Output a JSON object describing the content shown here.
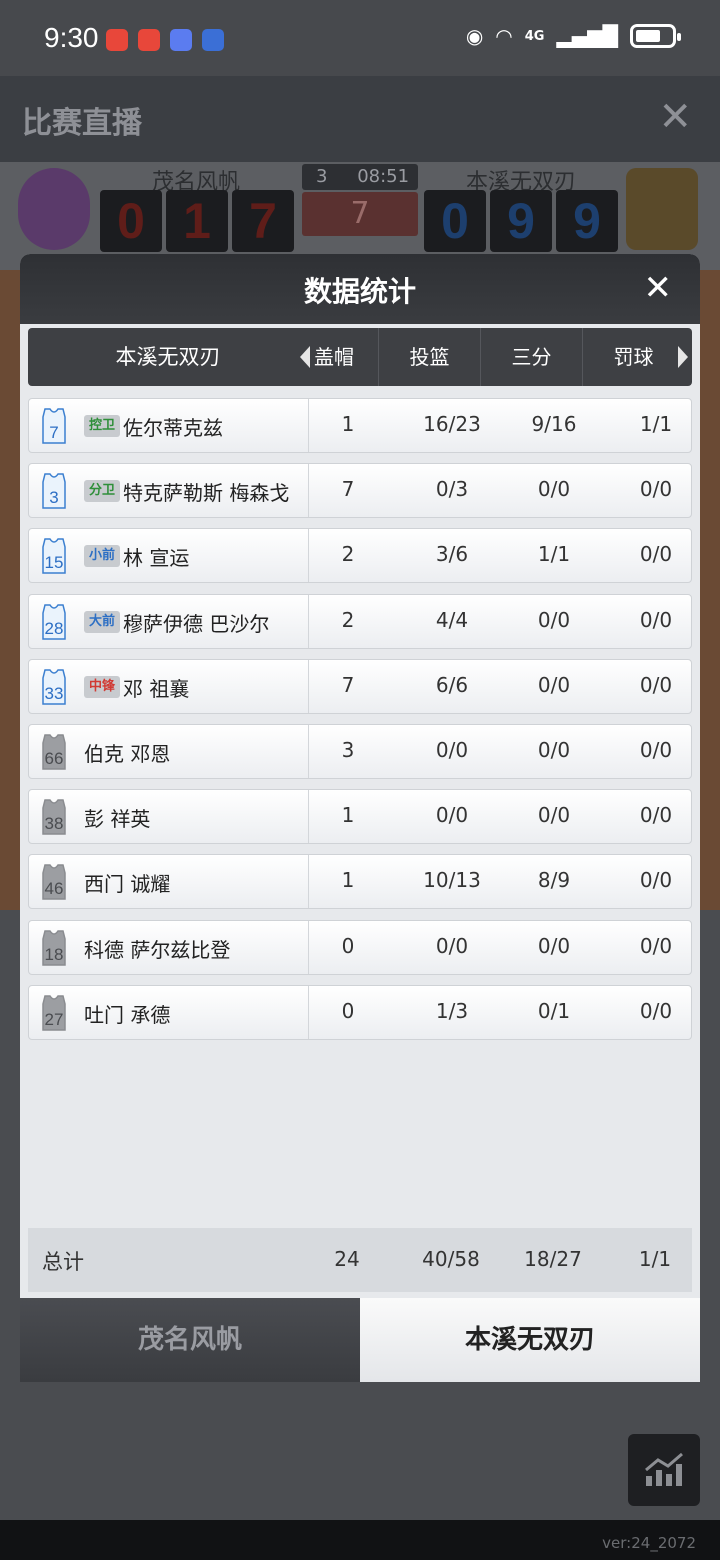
{
  "status_bar": {
    "time": "9:30",
    "network": "4G"
  },
  "background": {
    "title": "比赛直播",
    "home_team": "茂名风帆",
    "away_team": "本溪无双刃",
    "home_score_digits": [
      "0",
      "1",
      "7"
    ],
    "away_score_digits": [
      "0",
      "9",
      "9"
    ],
    "quarter": "3",
    "game_clock": "08:51",
    "center_value": "7",
    "version": "ver:24_2072"
  },
  "modal": {
    "title": "数据统计",
    "team": "本溪无双刃",
    "columns": [
      "盖帽",
      "投篮",
      "三分",
      "罚球"
    ],
    "players": [
      {
        "number": "7",
        "position": "控卫",
        "pos_color": "green",
        "name": "佐尔蒂克兹",
        "blk": "1",
        "fg": "16/23",
        "tp": "9/16",
        "ft": "1/1",
        "on_court": true
      },
      {
        "number": "3",
        "position": "分卫",
        "pos_color": "green",
        "name": "特克萨勒斯 梅森戈",
        "blk": "7",
        "fg": "0/3",
        "tp": "0/0",
        "ft": "0/0",
        "on_court": true
      },
      {
        "number": "15",
        "position": "小前",
        "pos_color": "blue",
        "name": "林 宣运",
        "blk": "2",
        "fg": "3/6",
        "tp": "1/1",
        "ft": "0/0",
        "on_court": true
      },
      {
        "number": "28",
        "position": "大前",
        "pos_color": "blue",
        "name": "穆萨伊德 巴沙尔",
        "blk": "2",
        "fg": "4/4",
        "tp": "0/0",
        "ft": "0/0",
        "on_court": true
      },
      {
        "number": "33",
        "position": "中锋",
        "pos_color": "red",
        "name": "邓 祖襄",
        "blk": "7",
        "fg": "6/6",
        "tp": "0/0",
        "ft": "0/0",
        "on_court": true
      },
      {
        "number": "66",
        "position": "",
        "pos_color": "",
        "name": "伯克 邓恩",
        "blk": "3",
        "fg": "0/0",
        "tp": "0/0",
        "ft": "0/0",
        "on_court": false
      },
      {
        "number": "38",
        "position": "",
        "pos_color": "",
        "name": "彭 祥英",
        "blk": "1",
        "fg": "0/0",
        "tp": "0/0",
        "ft": "0/0",
        "on_court": false
      },
      {
        "number": "46",
        "position": "",
        "pos_color": "",
        "name": "西门 诚耀",
        "blk": "1",
        "fg": "10/13",
        "tp": "8/9",
        "ft": "0/0",
        "on_court": false
      },
      {
        "number": "18",
        "position": "",
        "pos_color": "",
        "name": "科德 萨尔兹比登",
        "blk": "0",
        "fg": "0/0",
        "tp": "0/0",
        "ft": "0/0",
        "on_court": false
      },
      {
        "number": "27",
        "position": "",
        "pos_color": "",
        "name": "吐门 承德",
        "blk": "0",
        "fg": "1/3",
        "tp": "0/1",
        "ft": "0/0",
        "on_court": false
      }
    ],
    "total": {
      "label": "总计",
      "blk": "24",
      "fg": "40/58",
      "tp": "18/27",
      "ft": "1/1"
    },
    "tabs": {
      "home": "茂名风帆",
      "away": "本溪无双刃"
    }
  },
  "colors": {
    "pos_green": "#2f8f3a",
    "pos_blue": "#2d6fc4",
    "pos_red": "#d13a34",
    "home_digit": "#c0302a",
    "away_digit": "#2d6fc4"
  }
}
